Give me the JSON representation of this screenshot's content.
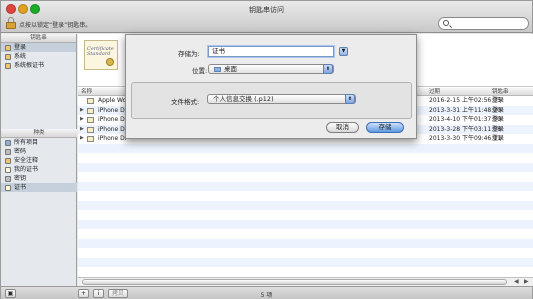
{
  "window": {
    "title": "钥匙串访问",
    "lock_hint": "点按以锁定“登录”钥匙串。"
  },
  "search": {
    "placeholder": ""
  },
  "sidebar": {
    "keychains_header": "钥匙串",
    "keychains": [
      {
        "label": "登录",
        "icon": "keychain-icon",
        "selected": true
      },
      {
        "label": "系统",
        "icon": "keychain-icon"
      },
      {
        "label": "系统根证书",
        "icon": "keychain-icon"
      }
    ],
    "categories_header": "种类",
    "categories": [
      {
        "label": "所有项目",
        "icon": "all-items-icon"
      },
      {
        "label": "密码",
        "icon": "password-icon"
      },
      {
        "label": "安全注释",
        "icon": "secure-note-icon"
      },
      {
        "label": "我的证书",
        "icon": "my-certificate-icon"
      },
      {
        "label": "密钥",
        "icon": "key-icon"
      },
      {
        "label": "证书",
        "icon": "certificate-icon",
        "selected": true
      }
    ]
  },
  "cert_preview": {
    "line1": "Certificate",
    "line2": "Standard"
  },
  "table": {
    "columns": {
      "name": "名称",
      "expires": "过期",
      "keychain": "钥匙串"
    },
    "rows": [
      {
        "name": "Apple Wo",
        "expires": "2016-2-15 上午02:56:35",
        "keychain": "登录",
        "expandable": false
      },
      {
        "name": "iPhone Di",
        "expires": "2013-3-31 上午11:48:20",
        "keychain": "登录",
        "expandable": true
      },
      {
        "name": "iPhone Di",
        "expires": "2013-4-10 下午01:37:50",
        "keychain": "登录",
        "expandable": true
      },
      {
        "name": "iPhone Di",
        "expires": "2013-3-28 下午03:11:58",
        "keychain": "登录",
        "expandable": true
      },
      {
        "name": "iPhone Di",
        "expires": "2013-3-30 下午09:46:11",
        "keychain": "登录",
        "expandable": true
      }
    ]
  },
  "footer": {
    "count": "5 项",
    "add": "+",
    "info": "i",
    "copy": "拷贝"
  },
  "dialog": {
    "save_as_label": "存储为:",
    "save_as_value": "证书",
    "where_label": "位置:",
    "where_value": "桌面",
    "format_label": "文件格式:",
    "format_value": "个人信息交换 (.p12)",
    "cancel": "取消",
    "save": "存储"
  },
  "colors": {
    "accent": "#5f99e2",
    "selection": "#c6d0dc",
    "row_stripe": "#edf3fe"
  }
}
